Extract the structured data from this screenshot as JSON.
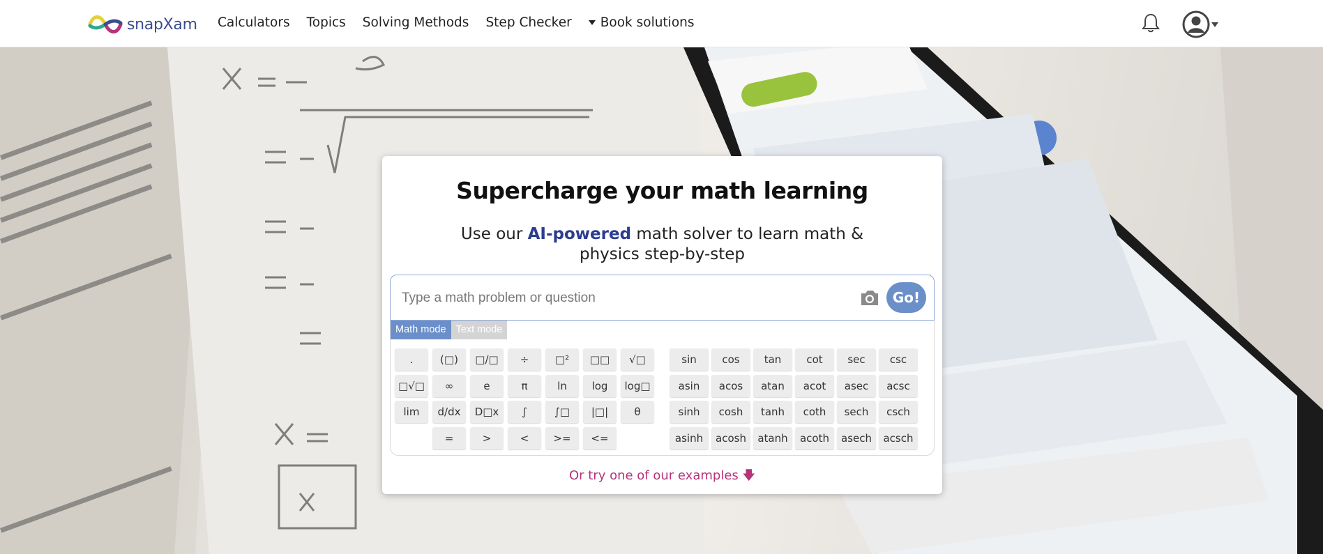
{
  "header": {
    "logo_text": "snapXam",
    "nav": [
      "Calculators",
      "Topics",
      "Solving Methods",
      "Step Checker",
      "Book solutions"
    ],
    "icons": [
      "bell-icon",
      "user-avatar-icon",
      "chevron-down-icon"
    ]
  },
  "hero": {
    "title": "Supercharge your math learning",
    "subtitle_pre": "Use our ",
    "subtitle_highlight": "AI-powered",
    "subtitle_post": " math solver to learn math & physics step-by-step",
    "search_placeholder": "Type a math problem or question",
    "go_label": "Go!",
    "modes": [
      "Math mode",
      "Text mode"
    ],
    "active_mode": "Math mode",
    "examples_link": "Or try one of our examples"
  },
  "keyboard": {
    "left": [
      [
        ".",
        "(□)",
        "□/□",
        "÷",
        "□²",
        "□□",
        "√□"
      ],
      [
        "□√□",
        "∞",
        "e",
        "π",
        "ln",
        "log",
        "log□"
      ],
      [
        "lim",
        "d/dx",
        "D□x",
        "∫",
        "∫□",
        "|□|",
        "θ"
      ],
      [
        "",
        "=",
        ">",
        "<",
        ">=",
        "<="
      ]
    ],
    "right": [
      [
        "sin",
        "cos",
        "tan",
        "cot",
        "sec",
        "csc"
      ],
      [
        "asin",
        "acos",
        "atan",
        "acot",
        "asec",
        "acsc"
      ],
      [
        "sinh",
        "cosh",
        "tanh",
        "coth",
        "sech",
        "csch"
      ],
      [
        "asinh",
        "acosh",
        "atanh",
        "acoth",
        "asech",
        "acsch"
      ]
    ]
  },
  "colors": {
    "brand_blue": "#3b4c8f",
    "accent_blue": "#6b8fc9",
    "link_pink": "#b5337a"
  }
}
